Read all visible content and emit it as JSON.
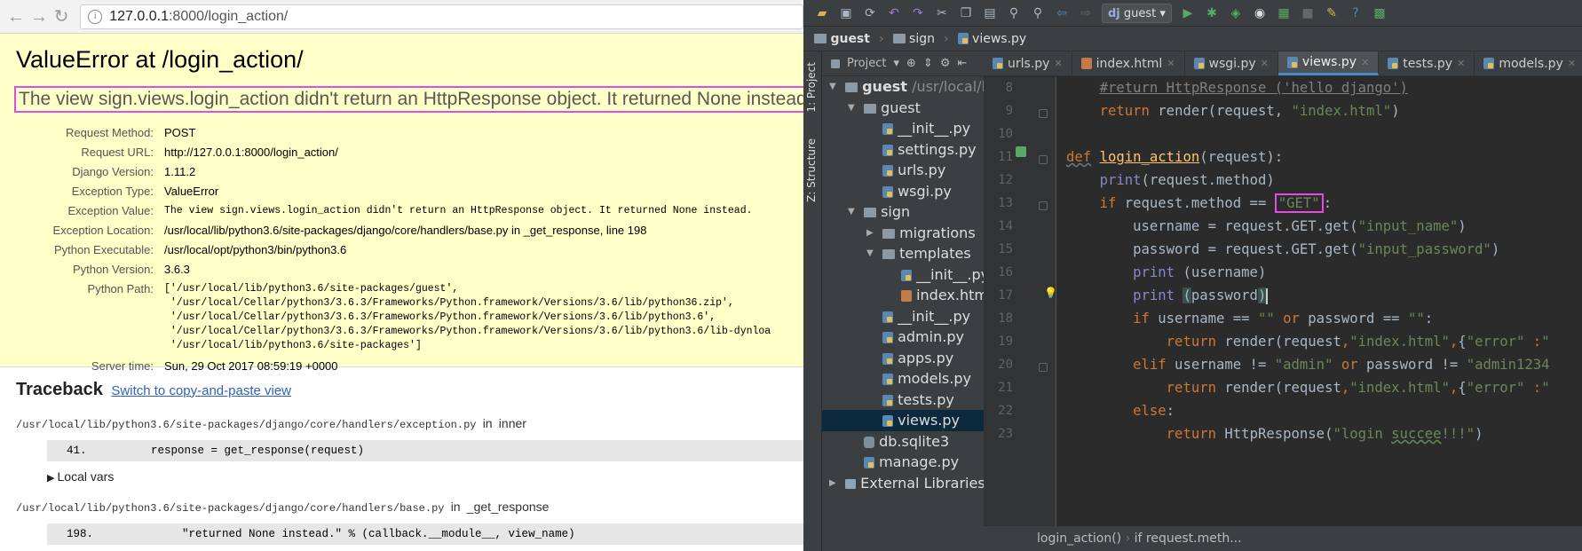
{
  "browser": {
    "url_host": "127.0.0.1",
    "url_path": ":8000/login_action/",
    "title": "ValueError at /login_action/",
    "exception_value": "The view sign.views.login_action didn't return an HttpResponse object. It returned None instead.",
    "meta": [
      {
        "key": "Request Method:",
        "value": "POST",
        "mono": false
      },
      {
        "key": "Request URL:",
        "value": "http://127.0.0.1:8000/login_action/",
        "mono": false
      },
      {
        "key": "Django Version:",
        "value": "1.11.2",
        "mono": false
      },
      {
        "key": "Exception Type:",
        "value": "ValueError",
        "mono": false
      },
      {
        "key": "Exception Value:",
        "value": "The view sign.views.login_action didn't return an HttpResponse object. It returned None instead.",
        "mono": true
      },
      {
        "key": "Exception Location:",
        "value": "/usr/local/lib/python3.6/site-packages/django/core/handlers/base.py in _get_response, line 198",
        "mono": false
      },
      {
        "key": "Python Executable:",
        "value": "/usr/local/opt/python3/bin/python3.6",
        "mono": false
      },
      {
        "key": "Python Version:",
        "value": "3.6.3",
        "mono": false
      }
    ],
    "python_path_key": "Python Path:",
    "python_path": [
      "['/usr/local/lib/python3.6/site-packages/guest',",
      " '/usr/local/Cellar/python3/3.6.3/Frameworks/Python.framework/Versions/3.6/lib/python36.zip',",
      " '/usr/local/Cellar/python3/3.6.3/Frameworks/Python.framework/Versions/3.6/lib/python3.6',",
      " '/usr/local/Cellar/python3/3.6.3/Frameworks/Python.framework/Versions/3.6/lib/python3.6/lib-dynloa",
      " '/usr/local/lib/python3.6/site-packages']"
    ],
    "server_time_key": "Server time:",
    "server_time": "Sun, 29 Oct 2017 08:59:19 +0000",
    "traceback_title": "Traceback",
    "traceback_link": "Switch to copy-and-paste view",
    "frames": [
      {
        "file": "/usr/local/lib/python3.6/site-packages/django/core/handlers/exception.py",
        "in": "in",
        "fn": "inner",
        "line": "41.",
        "code": "response = get_response(request)",
        "vars": "Local vars"
      },
      {
        "file": "/usr/local/lib/python3.6/site-packages/django/core/handlers/base.py",
        "in": "in",
        "fn": "_get_response",
        "line": "198.",
        "code": "\"returned None instead.\" % (callback.__module__, view_name)"
      }
    ]
  },
  "ide": {
    "run_config": "guest",
    "nav": [
      "guest",
      "sign",
      "views.py"
    ],
    "side_tabs": [
      "1: Project",
      "Z: Structure"
    ],
    "project_label": "Project",
    "tree": [
      {
        "label": "guest",
        "extra": "/usr/local/lib/",
        "icon": "folder",
        "depth": 0,
        "arrow": "▼",
        "bold": true
      },
      {
        "label": "guest",
        "icon": "folder",
        "depth": 1,
        "arrow": "▼"
      },
      {
        "label": "__init__.py",
        "icon": "py",
        "depth": 2
      },
      {
        "label": "settings.py",
        "icon": "py",
        "depth": 2
      },
      {
        "label": "urls.py",
        "icon": "py",
        "depth": 2
      },
      {
        "label": "wsgi.py",
        "icon": "py",
        "depth": 2
      },
      {
        "label": "sign",
        "icon": "folder",
        "depth": 1,
        "arrow": "▼"
      },
      {
        "label": "migrations",
        "icon": "folder",
        "depth": 2,
        "arrow": "▶"
      },
      {
        "label": "templates",
        "icon": "folder",
        "depth": 2,
        "arrow": "▼"
      },
      {
        "label": "__init__.py",
        "icon": "py",
        "depth": 3
      },
      {
        "label": "index.html",
        "icon": "html",
        "depth": 3
      },
      {
        "label": "__init__.py",
        "icon": "py",
        "depth": 2
      },
      {
        "label": "admin.py",
        "icon": "py",
        "depth": 2
      },
      {
        "label": "apps.py",
        "icon": "py",
        "depth": 2
      },
      {
        "label": "models.py",
        "icon": "py",
        "depth": 2
      },
      {
        "label": "tests.py",
        "icon": "py",
        "depth": 2
      },
      {
        "label": "views.py",
        "icon": "py",
        "depth": 2,
        "selected": true
      },
      {
        "label": "db.sqlite3",
        "icon": "db",
        "depth": 1
      },
      {
        "label": "manage.py",
        "icon": "py",
        "depth": 1
      },
      {
        "label": "External Libraries",
        "icon": "lib",
        "depth": 0,
        "arrow": "▶"
      }
    ],
    "tabs": [
      {
        "label": "urls.py",
        "icon": "py"
      },
      {
        "label": "index.html",
        "icon": "html"
      },
      {
        "label": "wsgi.py",
        "icon": "py"
      },
      {
        "label": "views.py",
        "icon": "py",
        "active": true
      },
      {
        "label": "tests.py",
        "icon": "py"
      },
      {
        "label": "models.py",
        "icon": "py"
      }
    ],
    "line_numbers": [
      "8",
      "9",
      "10",
      "11",
      "12",
      "13",
      "14",
      "15",
      "16",
      "17",
      "18",
      "19",
      "20",
      "21",
      "22",
      "23"
    ],
    "breadcrumb": [
      "login_action()",
      "if request.meth..."
    ]
  }
}
